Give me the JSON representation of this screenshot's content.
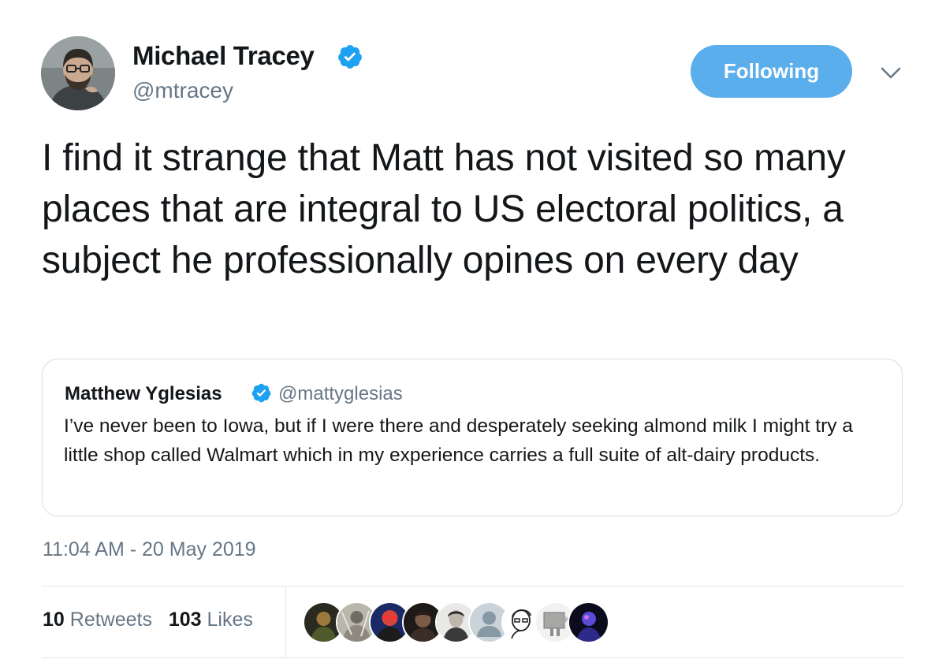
{
  "author": {
    "name": "Michael Tracey",
    "handle": "@mtracey",
    "verified": true,
    "avatar_icon": "profile-photo-bearded-man-glasses"
  },
  "follow_button": {
    "label": "Following"
  },
  "menu_icon": "chevron-down-icon",
  "tweet": {
    "text": "I find it strange that Matt has not visited so many places that are integral to US electoral politics, a subject he professionally opines on every day"
  },
  "quoted_tweet": {
    "name": "Matthew Yglesias",
    "handle": "@mattyglesias",
    "verified": true,
    "text": "I’ve never been to Iowa, but if I were there and desperately seeking almond milk I might try a little shop called Walmart which in my experience carries a full suite of alt-dairy products."
  },
  "timestamp": "11:04 AM - 20 May 2019",
  "stats": {
    "retweets_count": "10",
    "retweets_label": "Retweets",
    "likes_count": "103",
    "likes_label": "Likes"
  },
  "likers": [
    {
      "icon": "liker-avatar-1"
    },
    {
      "icon": "liker-avatar-2"
    },
    {
      "icon": "liker-avatar-3"
    },
    {
      "icon": "liker-avatar-4"
    },
    {
      "icon": "liker-avatar-5"
    },
    {
      "icon": "liker-avatar-default"
    },
    {
      "icon": "liker-avatar-7"
    },
    {
      "icon": "liker-avatar-8"
    },
    {
      "icon": "liker-avatar-9"
    }
  ],
  "colors": {
    "accent": "#1da1f2",
    "follow_button_bg": "#5aaeec",
    "secondary_text": "#657786",
    "primary_text": "#14171a",
    "border": "#d7dde2"
  }
}
